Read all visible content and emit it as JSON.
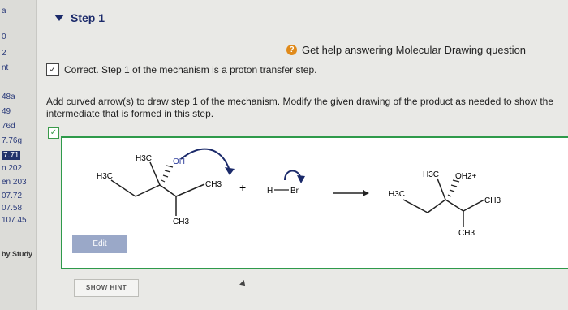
{
  "sidebar": {
    "items": [
      {
        "label": "a"
      },
      {
        "label": "0"
      },
      {
        "label": "2"
      },
      {
        "label": "nt"
      },
      {
        "label": "48a"
      },
      {
        "label": "49"
      },
      {
        "label": "76d"
      },
      {
        "label": "7.76g"
      },
      {
        "label": "7.71"
      },
      {
        "label": "n 202"
      },
      {
        "label": "en 203"
      },
      {
        "label": "07.72"
      },
      {
        "label": "07.58"
      },
      {
        "label": "107.45"
      }
    ],
    "footer": "by Study"
  },
  "step": {
    "title": "Step 1"
  },
  "help": {
    "label": "Get help answering Molecular Drawing question",
    "icon": "question-circle-icon"
  },
  "status": {
    "text": "Correct. Step 1 of the mechanism is a proton transfer step."
  },
  "instructions": {
    "text": "Add curved arrow(s) to draw step 1 of the mechanism. Modify the given drawing of the product as needed to show the intermediate that is formed in this step."
  },
  "editor": {
    "reactant": {
      "h3c_top": "H3C",
      "oh": "OH",
      "h3c_left": "H3C",
      "ch3_right": "CH3",
      "ch3_bottom": "CH3"
    },
    "plus": "+",
    "reagent": {
      "h": "H",
      "br": "Br"
    },
    "product": {
      "h3c_top": "H3C",
      "oh2": "OH2+",
      "h3c_left": "H3C",
      "ch3_right": "CH3",
      "ch3_bottom": "CH3"
    },
    "edit_label": "Edit"
  },
  "hint": {
    "label": "SHOW HINT"
  },
  "colors": {
    "accent_green": "#2e9a4a",
    "nav_blue": "#1b2a6a",
    "help_orange": "#e08a1a"
  }
}
